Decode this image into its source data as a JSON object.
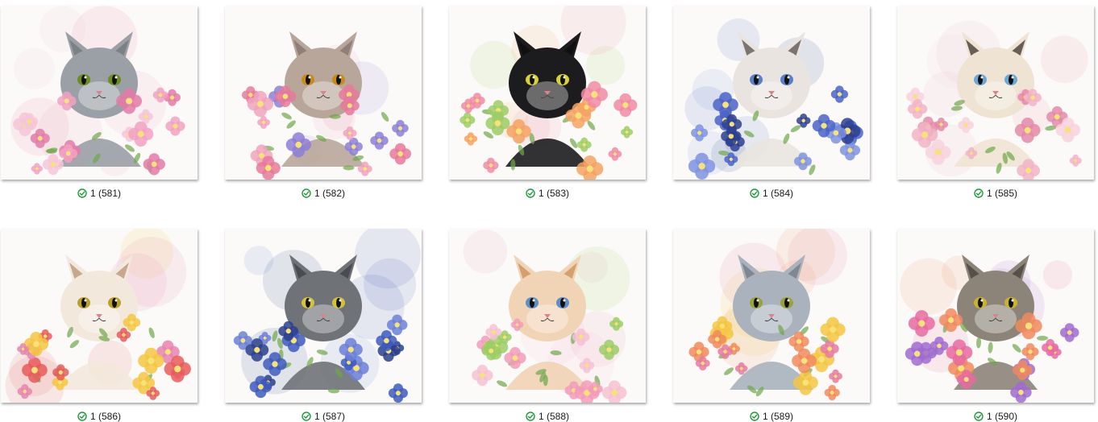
{
  "theme": {
    "status_color": "#1f9a3a",
    "background": "#ffffff"
  },
  "items": [
    {
      "label": "1 (581)",
      "status_icon": "check-circle-icon",
      "image": "watercolor-cat-thumbnail",
      "fur": "#9aa0a6",
      "eyes": "#6b8e23",
      "flowers": [
        "#f2a1c2",
        "#e37aa8",
        "#f6c6d8"
      ],
      "ears_dark": "#6f7378"
    },
    {
      "label": "1 (582)",
      "status_icon": "check-circle-icon",
      "image": "watercolor-cat-thumbnail",
      "fur": "#b8a69a",
      "eyes": "#c98a1a",
      "flowers": [
        "#e8799b",
        "#8c7fd6",
        "#f0a3bd"
      ],
      "ears_dark": "#7e6f6a"
    },
    {
      "label": "1 (583)",
      "status_icon": "check-circle-icon",
      "image": "watercolor-cat-thumbnail",
      "fur": "#1c1c1e",
      "eyes": "#d7d13a",
      "flowers": [
        "#f08aa5",
        "#f4a261",
        "#9ccc65"
      ],
      "ears_dark": "#0b0b0c"
    },
    {
      "label": "1 (584)",
      "status_icon": "check-circle-icon",
      "image": "watercolor-cat-thumbnail",
      "fur": "#e9e4df",
      "eyes": "#5a7fc8",
      "flowers": [
        "#4a63c8",
        "#7f93e0",
        "#2d3f8f"
      ],
      "ears_dark": "#4d4542"
    },
    {
      "label": "1 (585)",
      "status_icon": "check-circle-icon",
      "image": "watercolor-cat-thumbnail",
      "fur": "#efe3d3",
      "eyes": "#6ea6d6",
      "flowers": [
        "#f2b3c7",
        "#e48aa8",
        "#f7d2dd"
      ],
      "ears_dark": "#2f2521"
    },
    {
      "label": "1 (586)",
      "status_icon": "check-circle-icon",
      "image": "watercolor-cat-thumbnail",
      "fur": "#f3e8dc",
      "eyes": "#b9a12e",
      "flowers": [
        "#e85a5a",
        "#f4c542",
        "#e983b0"
      ],
      "ears_dark": "#b48b6b"
    },
    {
      "label": "1 (587)",
      "status_icon": "check-circle-icon",
      "image": "watercolor-cat-thumbnail",
      "fur": "#6f7277",
      "eyes": "#d4c23a",
      "flowers": [
        "#3e5bbd",
        "#6b80d8",
        "#2c3f8c"
      ],
      "ears_dark": "#3a3c40"
    },
    {
      "label": "1 (588)",
      "status_icon": "check-circle-icon",
      "image": "watercolor-cat-thumbnail",
      "fur": "#f1d3b6",
      "eyes": "#5d8fc6",
      "flowers": [
        "#f29bb8",
        "#f6c1d2",
        "#9ccc65"
      ],
      "ears_dark": "#c98a52"
    },
    {
      "label": "1 (589)",
      "status_icon": "check-circle-icon",
      "image": "watercolor-cat-thumbnail",
      "fur": "#a9b2bd",
      "eyes": "#9aa23a",
      "flowers": [
        "#f08a5d",
        "#f4c542",
        "#e87aa0"
      ],
      "ears_dark": "#6e7680"
    },
    {
      "label": "1 (590)",
      "status_icon": "check-circle-icon",
      "image": "watercolor-cat-thumbnail",
      "fur": "#8d8479",
      "eyes": "#c9b32e",
      "flowers": [
        "#a06bd1",
        "#f08a5d",
        "#e86aa0"
      ],
      "ears_dark": "#3f3a35"
    }
  ]
}
